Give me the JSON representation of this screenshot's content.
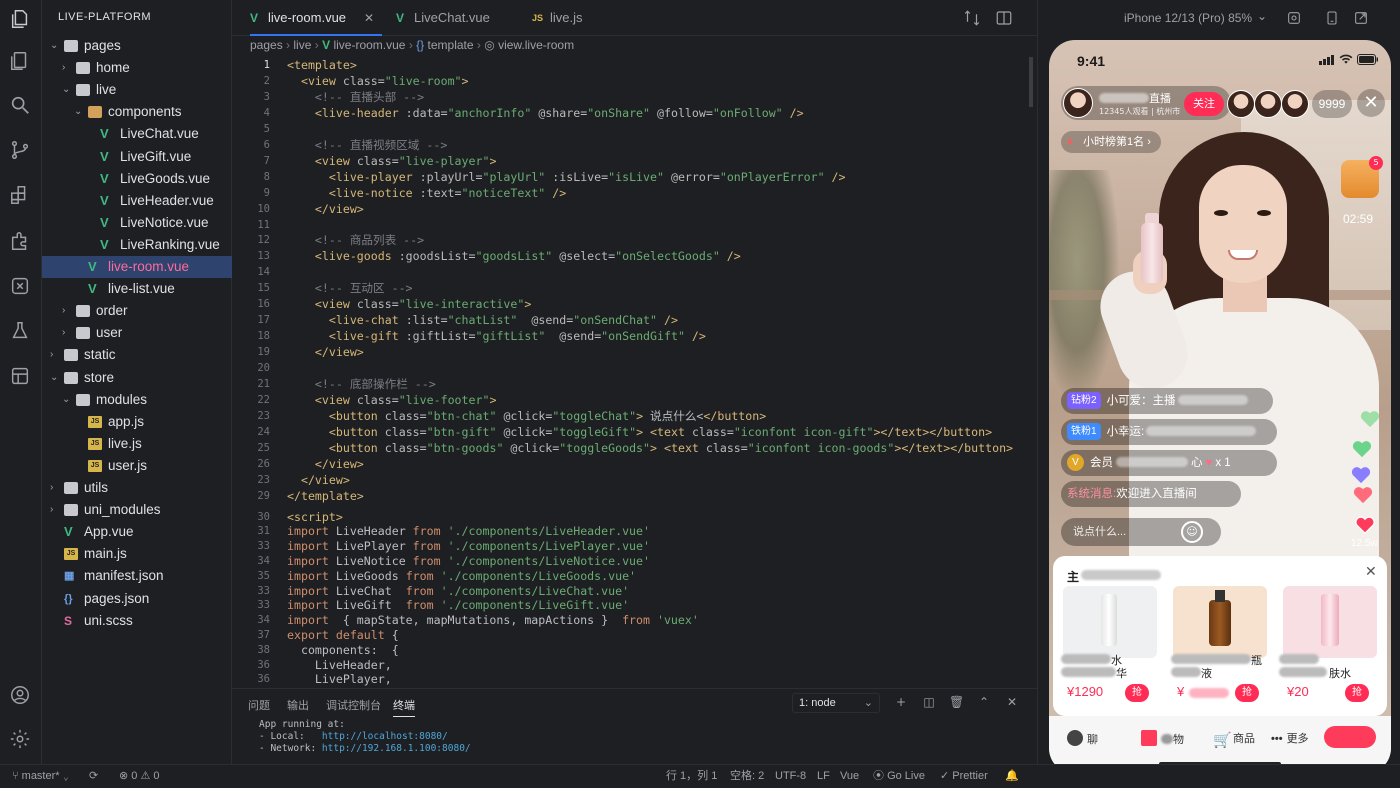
{
  "explorer": {
    "title": "LIVE-PLATFORM",
    "tree": [
      {
        "label": "pages",
        "type": "folder",
        "open": true,
        "depth": 0
      },
      {
        "label": "home",
        "type": "folder",
        "open": false,
        "depth": 1
      },
      {
        "label": "live",
        "type": "folder",
        "open": true,
        "depth": 1
      },
      {
        "label": "components",
        "type": "folder-special",
        "open": true,
        "depth": 2
      },
      {
        "label": "LiveChat.vue",
        "type": "vue",
        "depth": 3
      },
      {
        "label": "LiveGift.vue",
        "type": "vue",
        "depth": 3
      },
      {
        "label": "LiveGoods.vue",
        "type": "vue",
        "depth": 3
      },
      {
        "label": "LiveHeader.vue",
        "type": "vue",
        "depth": 3
      },
      {
        "label": "LiveNotice.vue",
        "type": "vue",
        "depth": 3
      },
      {
        "label": "LiveRanking.vue",
        "type": "vue",
        "depth": 3
      },
      {
        "label": "live-room.vue",
        "type": "vue",
        "depth": 2,
        "selected": true
      },
      {
        "label": "live-list.vue",
        "type": "vue",
        "depth": 2
      },
      {
        "label": "order",
        "type": "folder",
        "open": false,
        "depth": 1
      },
      {
        "label": "user",
        "type": "folder",
        "open": false,
        "depth": 1
      },
      {
        "label": "static",
        "type": "folder",
        "open": false,
        "depth": 0
      },
      {
        "label": "store",
        "type": "folder",
        "open": true,
        "depth": 0
      },
      {
        "label": "modules",
        "type": "folder",
        "open": true,
        "depth": 1
      },
      {
        "label": "app.js",
        "type": "js",
        "depth": 2
      },
      {
        "label": "live.js",
        "type": "js",
        "depth": 2
      },
      {
        "label": "user.js",
        "type": "js",
        "depth": 2
      },
      {
        "label": "utils",
        "type": "folder",
        "open": false,
        "depth": 0
      },
      {
        "label": "uni_modules",
        "type": "folder",
        "open": false,
        "depth": 0
      },
      {
        "label": "App.vue",
        "type": "vue",
        "depth": 0
      },
      {
        "label": "main.js",
        "type": "js",
        "depth": 0
      },
      {
        "label": "manifest.json",
        "type": "json",
        "depth": 0
      },
      {
        "label": "pages.json",
        "type": "json",
        "depth": 0
      },
      {
        "label": "uni.scss",
        "type": "scss",
        "depth": 0
      }
    ]
  },
  "tabs": [
    {
      "label": "live-room.vue",
      "icon": "V",
      "active": true
    },
    {
      "label": "LiveChat.vue",
      "icon": "V",
      "active": false
    },
    {
      "label": "live.js",
      "icon": "JS",
      "active": false
    }
  ],
  "breadcrumb": [
    "pages",
    "live",
    "live-room.vue",
    "template",
    "view.live-room"
  ],
  "code_lines": [
    {
      "n": "1",
      "html": "<span class='tg'>&lt;template&gt;</span>"
    },
    {
      "n": "2",
      "html": "  <span class='tg'>&lt;view</span> <span class='a'>class</span>=<span class='s'>\"live-room\"</span><span class='tg'>&gt;</span>"
    },
    {
      "n": "3",
      "html": "    <span class='c'>&lt;!-- 直播头部 --&gt;</span>"
    },
    {
      "n": "4",
      "html": "    <span class='tg'>&lt;live-header</span> <span class='a'>:data</span>=<span class='s'>\"anchorInfo\"</span> <span class='a'>@share</span>=<span class='s'>\"onShare\"</span> <span class='a'>@follow</span>=<span class='s'>\"onFollow\"</span> <span class='tg'>/&gt;</span>"
    },
    {
      "n": "5",
      "html": ""
    },
    {
      "n": "6",
      "html": "    <span class='c'>&lt;!-- 直播视频区域 --&gt;</span>"
    },
    {
      "n": "7",
      "html": "    <span class='tg'>&lt;view</span> <span class='a'>class</span>=<span class='s'>\"live-player\"</span><span class='tg'>&gt;</span>"
    },
    {
      "n": "8",
      "html": "      <span class='tg'>&lt;live-player</span> <span class='a'>:playUrl</span>=<span class='s'>\"playUrl\"</span> <span class='a'>:isLive</span>=<span class='s'>\"isLive\"</span> <span class='a'>@error</span>=<span class='s'>\"onPlayerError\"</span> <span class='tg'>/&gt;</span>"
    },
    {
      "n": "9",
      "html": "      <span class='tg'>&lt;live-notice</span> <span class='a'>:text</span>=<span class='s'>\"noticeText\"</span> <span class='tg'>/&gt;</span>"
    },
    {
      "n": "10",
      "html": "    <span class='tg'>&lt;/view&gt;</span>"
    },
    {
      "n": "11",
      "html": ""
    },
    {
      "n": "12",
      "html": "    <span class='c'>&lt;!-- 商品列表 --&gt;</span>"
    },
    {
      "n": "13",
      "html": "    <span class='tg'>&lt;live-goods</span> <span class='a'>:goodsList</span>=<span class='s'>\"goodsList\"</span> <span class='a'>@select</span>=<span class='s'>\"onSelectGoods\"</span> <span class='tg'>/&gt;</span>"
    },
    {
      "n": "14",
      "html": ""
    },
    {
      "n": "15",
      "html": "    <span class='c'>&lt;!-- 互动区 --&gt;</span>"
    },
    {
      "n": "16",
      "html": "    <span class='tg'>&lt;view</span> <span class='a'>class</span>=<span class='s'>\"live-interactive\"</span><span class='tg'>&gt;</span>"
    },
    {
      "n": "17",
      "html": "      <span class='tg'>&lt;live-chat</span> <span class='a'>:list</span>=<span class='s'>\"chatList\"</span>  <span class='a'>@send</span>=<span class='s'>\"onSendChat\"</span> <span class='tg'>/&gt;</span>"
    },
    {
      "n": "18",
      "html": "      <span class='tg'>&lt;live-gift</span> <span class='a'>:giftList</span>=<span class='s'>\"giftList\"</span>  <span class='a'>@send</span>=<span class='s'>\"onSendGift\"</span> <span class='tg'>/&gt;</span>"
    },
    {
      "n": "19",
      "html": "    <span class='tg'>&lt;/view&gt;</span>"
    },
    {
      "n": "20",
      "html": ""
    },
    {
      "n": "21",
      "html": "    <span class='c'>&lt;!-- 底部操作栏 --&gt;</span>"
    },
    {
      "n": "22",
      "html": "    <span class='tg'>&lt;view</span> <span class='a'>class</span>=<span class='s'>\"live-footer\"</span><span class='tg'>&gt;</span>"
    },
    {
      "n": "23",
      "html": "      <span class='tg'>&lt;button</span> <span class='a'>class</span>=<span class='s'>\"btn-chat\"</span> <span class='a'>@click</span>=<span class='s'>\"toggleChat\"</span><span class='tg'>&gt;</span> 说点什么&lt;<span class='tg'>&lt;/button&gt;</span>"
    },
    {
      "n": "24",
      "html": "      <span class='tg'>&lt;button</span> <span class='a'>class</span>=<span class='s'>\"btn-gift\"</span> <span class='a'>@click</span>=<span class='s'>\"toggleGift\"</span><span class='tg'>&gt;</span> <span class='tg'>&lt;text</span> <span class='a'>class</span>=<span class='s'>\"iconfont icon-gift\"</span><span class='tg'>&gt;&lt;/text&gt;&lt;/button&gt;</span>"
    },
    {
      "n": "25",
      "html": "      <span class='tg'>&lt;button</span> <span class='a'>class</span>=<span class='s'>\"btn-goods\"</span> <span class='a'>@click</span>=<span class='s'>\"toggleGoods\"</span><span class='tg'>&gt;</span> <span class='tg'>&lt;text</span> <span class='a'>class</span>=<span class='s'>\"iconfont icon-goods\"</span><span class='tg'>&gt;&lt;/text&gt;&lt;/button&gt;</span>"
    },
    {
      "n": "26",
      "html": "    <span class='tg'>&lt;/view&gt;</span>"
    },
    {
      "n": "27",
      "html": "  <span class='tg'>&lt;/view&gt;</span>"
    },
    {
      "n": "28",
      "html": "<span class='tg'>&lt;/template&gt;</span>"
    },
    {
      "n": "29",
      "html": "<span class='tg'>&lt;script&gt;</span>"
    },
    {
      "n": "30",
      "html": "<span class='k'>import</span> <span class='p'>LiveHeader</span> <span class='k'>from</span> <span class='s'>'./components/LiveHeader.vue'</span>"
    },
    {
      "n": "31",
      "html": "<span class='k'>import</span> <span class='p'>LivePlayer</span> <span class='k'>from</span> <span class='s'>'./components/LivePlayer.vue'</span>"
    },
    {
      "n": "32",
      "html": "<span class='k'>import</span> <span class='p'>LiveNotice</span> <span class='k'>from</span> <span class='s'>'./components/LiveNotice.vue'</span>"
    },
    {
      "n": "33",
      "html": "<span class='k'>import</span> <span class='p'>LiveGoods</span> <span class='k'>from</span> <span class='s'>'./components/LiveGoods.vue'</span>"
    },
    {
      "n": "34",
      "html": "<span class='k'>import</span> <span class='p'>LiveChat</span>  <span class='k'>from</span> <span class='s'>'./components/LiveChat.vue'</span>"
    },
    {
      "n": "35",
      "html": "<span class='k'>import</span> <span class='p'>LiveGift</span>  <span class='k'>from</span> <span class='s'>'./components/LiveGift.vue'</span>"
    },
    {
      "n": "36",
      "html": "<span class='k'>import</span>  { mapState, mapMutations, mapActions }  <span class='k'>from</span> <span class='s'>'vuex'</span>"
    },
    {
      "n": "37",
      "html": "<span class='k'>export default</span> {"
    },
    {
      "n": "38",
      "html": "  components:  {"
    },
    {
      "n": "39",
      "html": "    LiveHeader,"
    },
    {
      "n": "40",
      "html": "    LivePlayer,"
    }
  ],
  "gutter_labels": [
    "1",
    "2",
    "3",
    "4",
    "5",
    "6",
    "7",
    "8",
    "9",
    "10",
    "11",
    "12",
    "13",
    "14",
    "15",
    "16",
    "17",
    "18",
    "19",
    "20",
    "21",
    "22",
    "23",
    "24",
    "25",
    "26",
    "23",
    "29",
    "30",
    "31",
    "33",
    "34",
    "35",
    "33",
    "33",
    "34",
    "37",
    "38",
    "36",
    "36",
    "8"
  ],
  "panel": {
    "tabs": [
      "问题",
      "输出",
      "调试控制台",
      "终端"
    ],
    "active_tab": "终端",
    "terminal_select": "1: node",
    "terminal_lines": [
      {
        "pre": "App running at:",
        "url": ""
      },
      {
        "pre": "- Local:   ",
        "url": "http://localhost:8080/"
      },
      {
        "pre": "- Network: ",
        "url": "http://192.168.1.100:8080/"
      }
    ]
  },
  "statusbar": {
    "branch": "master*",
    "errors": "0",
    "warnings": "0",
    "position": "行 1，列 1",
    "spaces": "空格: 2",
    "encoding": "UTF-8",
    "eol": "LF",
    "language": "Vue",
    "golive": "Go Live",
    "prettier": "Prettier"
  },
  "preview": {
    "device": "iPhone 12/13 (Pro) 85%",
    "time": "9:41",
    "anchor_title": "直播",
    "anchor_meta": "12345人观看 | 杭州市",
    "follow_label": "关注",
    "viewer_count": "9999",
    "rank_label": "小时榜第1名",
    "gift_badge": "5",
    "timer": "02:59",
    "chat": [
      {
        "badge": "钻粉2",
        "badge_color": "#7b61ff",
        "text": "小可爱：主播"
      },
      {
        "badge": "铁粉1",
        "badge_color": "#3d8bff",
        "text": "小幸运:"
      },
      {
        "badge": "V",
        "badge_color": "#e0a72a",
        "text": "会员",
        "suffix_a": "心",
        "suffix_b": "x 1"
      },
      {
        "badge": "",
        "badge_color": "",
        "text": "欢迎进入直播间",
        "prefix": "系统消息:"
      }
    ],
    "say_placeholder": "说点什么...",
    "like_count": "12.5w",
    "goods_title": "主",
    "goods": [
      {
        "name_a": "水",
        "name_b": "华",
        "price": "¥1290",
        "grab": "抢",
        "color": "#eef0f2"
      },
      {
        "name_a": "瓶",
        "name_b": "液",
        "price": "¥",
        "grab": "抢",
        "color": "#f6e2cf"
      },
      {
        "name_a": "",
        "name_b": "肤水",
        "price": "¥20",
        "grab": "抢",
        "color": "#f8dfe4"
      }
    ],
    "bottom": [
      {
        "label": "聊",
        "icon": "chat-bubble-icon"
      },
      {
        "label": "物",
        "icon": "gift-icon"
      },
      {
        "label": "商品",
        "icon": "cart-icon"
      },
      {
        "label": "更多",
        "icon": "more-icon"
      }
    ],
    "colors": {
      "accent": "#ff2d55",
      "vue": "#41b883",
      "selected": "#2e436e",
      "link": "#4fa6d8"
    }
  }
}
